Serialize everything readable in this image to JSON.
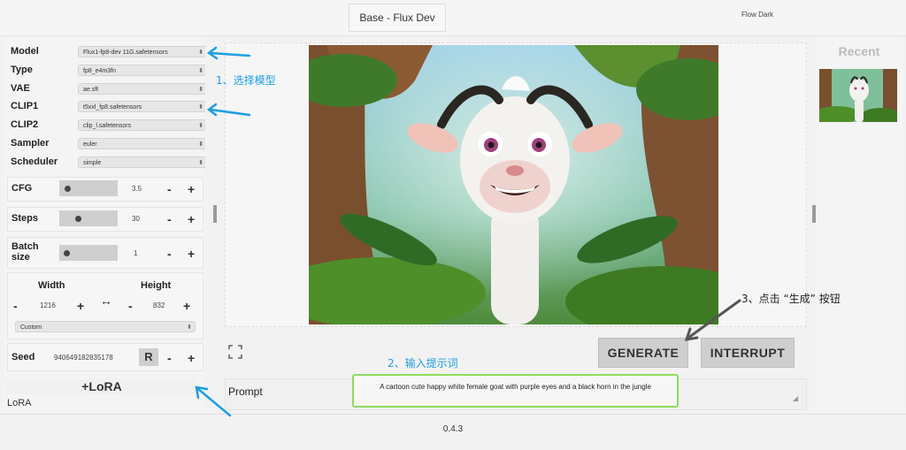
{
  "header": {
    "title": "Base - Flux Dev",
    "theme": "Flow Dark"
  },
  "sidebar": {
    "selects": [
      {
        "label": "Model",
        "value": "Flux1-fp8-dev 11G.safetensors"
      },
      {
        "label": "Type",
        "value": "fp8_e4m3fn"
      },
      {
        "label": "VAE",
        "value": "ae.sft"
      },
      {
        "label": "CLIP1",
        "value": "t5xxl_fp8.safetensors"
      },
      {
        "label": "CLIP2",
        "value": "clip_l.safetensors"
      },
      {
        "label": "Sampler",
        "value": "euler"
      },
      {
        "label": "Scheduler",
        "value": "simple"
      }
    ],
    "cfg": {
      "label": "CFG",
      "value": "3.5"
    },
    "steps": {
      "label": "Steps",
      "value": "30"
    },
    "batch": {
      "label": "Batch size",
      "value": "1"
    },
    "width": {
      "label": "Width",
      "value": "1216"
    },
    "height": {
      "label": "Height",
      "value": "832"
    },
    "swap_glyph": "↔",
    "preset": "Custom",
    "seed": {
      "label": "Seed",
      "value": "940649182835178",
      "random_btn": "R"
    },
    "lora_button": "+LoRA",
    "lora_label": "LoRA",
    "minus": "-",
    "plus": "+"
  },
  "main": {
    "generate": "GENERATE",
    "interrupt": "INTERRUPT",
    "prompt_label": "Prompt",
    "prompt_text": "A cartoon cute happy white female goat with purple eyes and a black horn in the jungle"
  },
  "recent": {
    "label": "Recent"
  },
  "footer": {
    "version": "0.4.3"
  },
  "annotations": {
    "step1": "1、选择模型",
    "step2": "2、输入提示词",
    "step3": "3、点击 “生成” 按钮"
  },
  "colors": {
    "annotation_blue": "#1e9ee0",
    "prompt_highlight": "#8ddc5e"
  }
}
